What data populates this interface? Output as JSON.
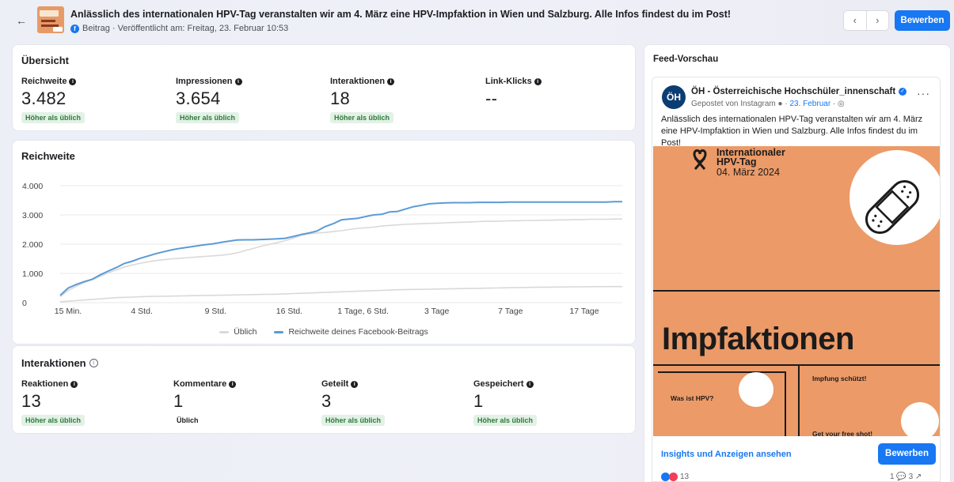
{
  "header": {
    "back_icon": "arrow-left-icon",
    "title": "Anlässlich des internationalen HPV-Tag veranstalten wir am 4. März eine HPV-Impfaktion in Wien und Salzburg. Alle Infos findest du im Post!",
    "meta": "Beitrag · Veröffentlicht am: Freitag, 23. Februar 10:53",
    "prev_icon": "‹",
    "next_icon": "›",
    "promote_label": "Bewerben"
  },
  "overview": {
    "title": "Übersicht",
    "metrics": [
      {
        "label": "Reichweite",
        "value": "3.482",
        "badge": "Höher als üblich"
      },
      {
        "label": "Impressionen",
        "value": "3.654",
        "badge": "Höher als üblich"
      },
      {
        "label": "Interaktionen",
        "value": "18",
        "badge": "Höher als üblich"
      },
      {
        "label": "Link-Klicks",
        "value": "--",
        "badge": ""
      }
    ]
  },
  "reach": {
    "title": "Reichweite",
    "legend_typical": "Üblich",
    "legend_post": "Reichweite deines Facebook-Beitrags"
  },
  "chart_data": {
    "type": "line",
    "title": "Reichweite",
    "y_ticks": [
      "0",
      "1.000",
      "2.000",
      "3.000",
      "4.000"
    ],
    "ylim": [
      0,
      4000
    ],
    "x_tick_labels": [
      "15 Min.",
      "4 Std.",
      "9 Std.",
      "16 Std.",
      "1 Tage, 6 Std.",
      "3 Tage",
      "7 Tage",
      "17 Tage"
    ],
    "x": [
      0,
      1,
      2,
      3,
      4,
      5,
      6,
      7,
      8,
      9,
      10,
      11,
      12,
      13,
      14,
      15,
      16,
      17,
      18,
      19,
      20,
      21,
      22,
      23,
      24,
      25,
      26,
      27,
      28,
      29,
      30,
      31,
      32,
      33,
      34,
      35,
      36,
      37,
      38,
      39,
      40,
      41,
      42,
      43,
      44,
      45,
      46,
      47,
      48,
      49,
      50,
      51,
      52,
      53,
      54,
      55,
      56,
      57,
      58,
      59,
      60,
      61,
      62,
      63,
      64,
      65,
      66,
      67,
      68,
      69,
      70
    ],
    "series": [
      {
        "name": "Reichweite deines Facebook-Beitrags",
        "color": "#5b9bd5",
        "values": [
          250,
          500,
          620,
          720,
          800,
          950,
          1080,
          1200,
          1340,
          1420,
          1520,
          1600,
          1680,
          1750,
          1810,
          1860,
          1900,
          1940,
          1980,
          2010,
          2060,
          2100,
          2140,
          2150,
          2150,
          2160,
          2170,
          2180,
          2200,
          2260,
          2330,
          2380,
          2450,
          2600,
          2700,
          2830,
          2860,
          2880,
          2940,
          3000,
          3020,
          3100,
          3120,
          3200,
          3280,
          3330,
          3380,
          3400,
          3410,
          3420,
          3420,
          3420,
          3430,
          3430,
          3430,
          3430,
          3440,
          3440,
          3440,
          3440,
          3440,
          3440,
          3440,
          3440,
          3440,
          3440,
          3440,
          3440,
          3440,
          3450,
          3450
        ]
      },
      {
        "name": "Üblich (oberer Bereich)",
        "color": "#d9d9d9",
        "values": [
          200,
          420,
          560,
          690,
          790,
          900,
          1020,
          1120,
          1220,
          1290,
          1350,
          1400,
          1440,
          1470,
          1500,
          1520,
          1540,
          1560,
          1580,
          1600,
          1620,
          1650,
          1700,
          1780,
          1850,
          1930,
          1990,
          2050,
          2120,
          2200,
          2300,
          2350,
          2380,
          2400,
          2430,
          2460,
          2500,
          2540,
          2560,
          2580,
          2620,
          2640,
          2660,
          2680,
          2690,
          2700,
          2710,
          2720,
          2730,
          2740,
          2750,
          2760,
          2770,
          2780,
          2780,
          2790,
          2800,
          2800,
          2810,
          2810,
          2820,
          2820,
          2830,
          2830,
          2840,
          2840,
          2850,
          2850,
          2850,
          2860,
          2860
        ]
      },
      {
        "name": "Üblich (unterer Bereich)",
        "color": "#d9d9d9",
        "values": [
          30,
          50,
          70,
          90,
          110,
          130,
          150,
          170,
          180,
          190,
          200,
          210,
          215,
          220,
          225,
          230,
          235,
          240,
          245,
          250,
          255,
          260,
          265,
          270,
          275,
          280,
          285,
          290,
          300,
          310,
          320,
          330,
          340,
          350,
          360,
          370,
          380,
          390,
          400,
          410,
          420,
          430,
          440,
          445,
          450,
          455,
          460,
          465,
          470,
          475,
          480,
          485,
          490,
          495,
          500,
          505,
          510,
          515,
          520,
          525,
          530,
          530,
          535,
          535,
          540,
          540,
          545,
          545,
          550,
          550,
          550
        ]
      }
    ]
  },
  "interactions": {
    "title": "Interaktionen",
    "info_icon": "info-circle-icon",
    "metrics": [
      {
        "label": "Reaktionen",
        "value": "13",
        "badge": "Höher als üblich",
        "badge_style": "green"
      },
      {
        "label": "Kommentare",
        "value": "1",
        "badge": "Üblich",
        "badge_style": "grey"
      },
      {
        "label": "Geteilt",
        "value": "3",
        "badge": "Höher als üblich",
        "badge_style": "green"
      },
      {
        "label": "Gespeichert",
        "value": "1",
        "badge": "Höher als üblich",
        "badge_style": "green"
      }
    ]
  },
  "feed": {
    "title": "Feed-Vorschau",
    "page_initials": "ÖH",
    "page_name": "ÖH - Österreichische Hochschüler_innenschaft",
    "posted_via": "Gepostet von Instagram",
    "posted_date": "23. Februar",
    "more_icon": "···",
    "text": "Anlässlich des internationalen HPV-Tag veranstalten wir am 4. März eine HPV-Impfaktion in Wien und Salzburg. Alle Infos findest du im Post!",
    "poster": {
      "tag_title_1": "Internationaler",
      "tag_title_2": "HPV-Tag",
      "tag_date": "04. März 2024",
      "headline": "Impfaktionen",
      "left_head": "Was ist HPV?",
      "right_head_1": "Impfung schützt!",
      "right_head_2": "Get your free shot!"
    },
    "insights_label": "Insights und Anzeigen ansehen",
    "promote_label": "Bewerben",
    "reaction_count": "13",
    "comments_shares": "1 💬  3 ↗"
  }
}
